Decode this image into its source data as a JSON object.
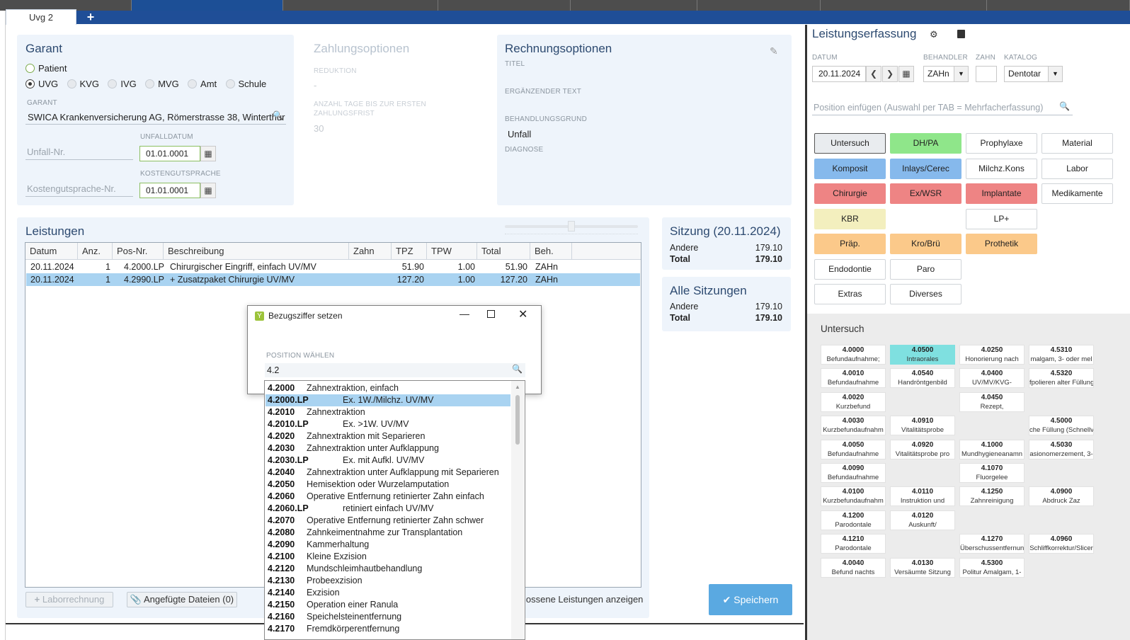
{
  "tabs": {
    "active": "Uvg 2",
    "add": "+"
  },
  "garant": {
    "title": "Garant",
    "radio_patient": "Patient",
    "radios": [
      "UVG",
      "KVG",
      "IVG",
      "MVG",
      "Amt",
      "Schule"
    ],
    "garant_label": "GARANT",
    "garant_value": "SWICA Krankenversicherung AG, Römerstrasse 38, Winterthur",
    "unfallnr_placeholder": "Unfall-Nr.",
    "unfalldatum_label": "UNFALLDATUM",
    "unfalldatum_value": "01.01.0001",
    "kostengutsprache_placeholder": "Kostengutsprache-Nr.",
    "kostengutsprache_label": "KOSTENGUTSPRACHE",
    "kostengutsprache_value": "01.01.0001"
  },
  "zahlung": {
    "title": "Zahlungsoptionen",
    "reduktion_label": "REDUKTION",
    "reduktion_value": "-",
    "tage_label": "ANZAHL TAGE BIS ZUR ERSTEN ZAHLUNGSFRIST",
    "tage_value": "30"
  },
  "rechnung": {
    "title": "Rechnungsoptionen",
    "titel_label": "TITEL",
    "ergaenzend_label": "ERGÄNZENDER TEXT",
    "grund_label": "BEHANDLUNGSGRUND",
    "grund_value": "Unfall",
    "diagnose_label": "DIAGNOSE"
  },
  "leistungen": {
    "title": "Leistungen",
    "columns": [
      "Datum",
      "Anz.",
      "Pos-Nr.",
      "Beschreibung",
      "Zahn",
      "TPZ",
      "TPW",
      "Total",
      "Beh."
    ],
    "rows": [
      {
        "datum": "20.11.2024",
        "anz": "1",
        "pos": "4.2000.LP",
        "beschr": "Chirurgischer Eingriff, einfach UV/MV",
        "zahn": "",
        "tpz": "51.90",
        "tpw": "1.00",
        "total": "51.90",
        "beh": "ZAHn"
      },
      {
        "datum": "20.11.2024",
        "anz": "1",
        "pos": "4.2990.LP",
        "beschr": "+ Zusatzpaket Chirurgie UV/MV",
        "zahn": "",
        "tpz": "127.20",
        "tpw": "1.00",
        "total": "127.20",
        "beh": "ZAHn"
      }
    ],
    "laborrechnung": "Laborrechnung",
    "dateien": "Angefügte Dateien (0)",
    "abgeschlossen": "lossene Leistungen anzeigen",
    "speichern": "Speichern"
  },
  "sitzung": {
    "title": "Sitzung (20.11.2024)",
    "andere_label": "Andere",
    "andere_value": "179.10",
    "total_label": "Total",
    "total_value": "179.10"
  },
  "alle": {
    "title": "Alle Sitzungen",
    "andere_label": "Andere",
    "andere_value": "179.10",
    "total_label": "Total",
    "total_value": "179.10"
  },
  "erfassung": {
    "title": "Leistungserfassung",
    "datum_label": "DATUM",
    "datum_value": "20.11.2024",
    "behandler_label": "BEHANDLER",
    "behandler_value": "ZAHn",
    "zahn_label": "ZAHN",
    "katalog_label": "KATALOG",
    "katalog_value": "Dentotar",
    "search_placeholder": "Position einfügen (Auswahl per TAB = Mehrfacherfassung)",
    "categories": [
      {
        "label": "Untersuch",
        "color": "#e9ecef",
        "bordercolor": "#555"
      },
      {
        "label": "DH/PA",
        "color": "#8fe68a"
      },
      {
        "label": "Prophylaxe",
        "color": "#ffffff"
      },
      {
        "label": "Material",
        "color": "#ffffff"
      },
      {
        "label": "Komposit",
        "color": "#86b9ec"
      },
      {
        "label": "Inlays/Cerec",
        "color": "#86b9ec"
      },
      {
        "label": "Milchz.Kons",
        "color": "#ffffff"
      },
      {
        "label": "Labor",
        "color": "#ffffff"
      },
      {
        "label": "Chirurgie",
        "color": "#ee8484"
      },
      {
        "label": "Ex/WSR",
        "color": "#ee8484"
      },
      {
        "label": "Implantate",
        "color": "#ee8484"
      },
      {
        "label": "Medikamente",
        "color": "#ffffff"
      },
      {
        "label": "KBR",
        "color": "#f3efbe"
      },
      {
        "label": "LP+",
        "color": "#ffffff"
      },
      {
        "label": "Präp.",
        "color": "#fbc98a"
      },
      {
        "label": "Kro/Brü",
        "color": "#fbc98a"
      },
      {
        "label": "Prothetik",
        "color": "#fbc98a"
      },
      {
        "label": "Endodontie",
        "color": "#ffffff"
      },
      {
        "label": "Paro",
        "color": "#ffffff"
      },
      {
        "label": "Extras",
        "color": "#ffffff"
      },
      {
        "label": "Diverses",
        "color": "#ffffff"
      }
    ],
    "section_title": "Untersuch",
    "positions": [
      {
        "n": "4.0000",
        "d": "Befundaufnahme;",
        "col": 0,
        "row": 0
      },
      {
        "n": "4.0500",
        "d": "Intraorales",
        "col": 1,
        "row": 0,
        "hl": true
      },
      {
        "n": "4.0250",
        "d": "Honorierung nach",
        "col": 2,
        "row": 0
      },
      {
        "n": "4.5310",
        "d": "malgam, 3- oder mel",
        "col": 3,
        "row": 0
      },
      {
        "n": "4.0010",
        "d": "Befundaufnahme",
        "col": 0,
        "row": 1
      },
      {
        "n": "4.0540",
        "d": "Handröntgenbild",
        "col": 1,
        "row": 1
      },
      {
        "n": "4.0400",
        "d": "UV/MV/KVG-",
        "col": 2,
        "row": 1
      },
      {
        "n": "4.5320",
        "d": "fpolieren alter Füllung",
        "col": 3,
        "row": 1
      },
      {
        "n": "4.0020",
        "d": "Kurzbefund",
        "col": 0,
        "row": 2
      },
      {
        "n": "4.0450",
        "d": "Rezept,",
        "col": 2,
        "row": 2
      },
      {
        "n": "4.0030",
        "d": "Kurzbefundaufnahm",
        "col": 0,
        "row": 3
      },
      {
        "n": "4.0910",
        "d": "Vitalitätsprobe",
        "col": 1,
        "row": 3
      },
      {
        "n": "4.5000",
        "d": "che Füllung (Schnellv",
        "col": 3,
        "row": 3
      },
      {
        "n": "4.0050",
        "d": "Befundaufnahme",
        "col": 0,
        "row": 4
      },
      {
        "n": "4.0920",
        "d": "Vitalitätsprobe pro",
        "col": 1,
        "row": 4
      },
      {
        "n": "4.1000",
        "d": "Mundhygieneanamn",
        "col": 2,
        "row": 4
      },
      {
        "n": "4.5030",
        "d": "asionomerzement, 3-",
        "col": 3,
        "row": 4
      },
      {
        "n": "4.0090",
        "d": "Befundaufnahme",
        "col": 0,
        "row": 5
      },
      {
        "n": "4.1070",
        "d": "Fluorgelee",
        "col": 2,
        "row": 5
      },
      {
        "n": "4.0100",
        "d": "Kurzbefundaufnahm",
        "col": 0,
        "row": 6
      },
      {
        "n": "4.0110",
        "d": "Instruktion und",
        "col": 1,
        "row": 6
      },
      {
        "n": "4.1250",
        "d": "Zahnreinigung",
        "col": 2,
        "row": 6
      },
      {
        "n": "4.0900",
        "d": "Abdruck Zaz",
        "col": 3,
        "row": 6
      },
      {
        "n": "4.1200",
        "d": "Parodontale",
        "col": 0,
        "row": 7
      },
      {
        "n": "4.0120",
        "d": "Auskunft/",
        "col": 1,
        "row": 7
      },
      {
        "n": "4.1210",
        "d": "Parodontale",
        "col": 0,
        "row": 8
      },
      {
        "n": "4.1270",
        "d": "Überschussentfernun",
        "col": 2,
        "row": 8
      },
      {
        "n": "4.0960",
        "d": "Schliffkorrektur/Slicer",
        "col": 3,
        "row": 8
      },
      {
        "n": "4.0040",
        "d": "Befund nachts",
        "col": 0,
        "row": 9
      },
      {
        "n": "4.0130",
        "d": "Versäumte Sitzung",
        "col": 1,
        "row": 9
      },
      {
        "n": "4.5300",
        "d": "Politur Amalgam, 1-",
        "col": 2,
        "row": 9
      }
    ]
  },
  "dialog": {
    "title": "Bezugsziffer setzen",
    "label": "POSITION WÄHLEN",
    "value": "4.2",
    "items": [
      {
        "k": "4.2000",
        "t": "Zahnextraktion, einfach",
        "lp": false
      },
      {
        "k": "4.2000.LP",
        "t": "Ex. 1W./Milchz. UV/MV",
        "lp": true,
        "sel": true
      },
      {
        "k": "4.2010",
        "t": "Zahnextraktion",
        "lp": false
      },
      {
        "k": "4.2010.LP",
        "t": "Ex. >1W. UV/MV",
        "lp": true
      },
      {
        "k": "4.2020",
        "t": "Zahnextraktion mit Separieren",
        "lp": false
      },
      {
        "k": "4.2030",
        "t": "Zahnextraktion unter Aufklappung",
        "lp": false
      },
      {
        "k": "4.2030.LP",
        "t": "Ex. mit Aufkl. UV/MV",
        "lp": true
      },
      {
        "k": "4.2040",
        "t": "Zahnextraktion unter Aufklappung mit Separieren",
        "lp": false
      },
      {
        "k": "4.2050",
        "t": "Hemisektion oder Wurzelamputation",
        "lp": false
      },
      {
        "k": "4.2060",
        "t": "Operative Entfernung retinierter Zahn einfach",
        "lp": false
      },
      {
        "k": "4.2060.LP",
        "t": "retiniert einfach UV/MV",
        "lp": true
      },
      {
        "k": "4.2070",
        "t": "Operative Entfernung retinierter Zahn schwer",
        "lp": false
      },
      {
        "k": "4.2080",
        "t": "Zahnkeimentnahme zur Transplantation",
        "lp": false
      },
      {
        "k": "4.2090",
        "t": "Kammerhaltung",
        "lp": false
      },
      {
        "k": "4.2100",
        "t": "Kleine Exzision",
        "lp": false
      },
      {
        "k": "4.2120",
        "t": "Mundschleimhautbehandlung",
        "lp": false
      },
      {
        "k": "4.2130",
        "t": "Probeexzision",
        "lp": false
      },
      {
        "k": "4.2140",
        "t": "Exzision",
        "lp": false
      },
      {
        "k": "4.2150",
        "t": "Operation einer Ranula",
        "lp": false
      },
      {
        "k": "4.2160",
        "t": "Speichelsteinentfernung",
        "lp": false
      },
      {
        "k": "4.2170",
        "t": "Fremdkörperentfernung",
        "lp": false
      }
    ]
  }
}
